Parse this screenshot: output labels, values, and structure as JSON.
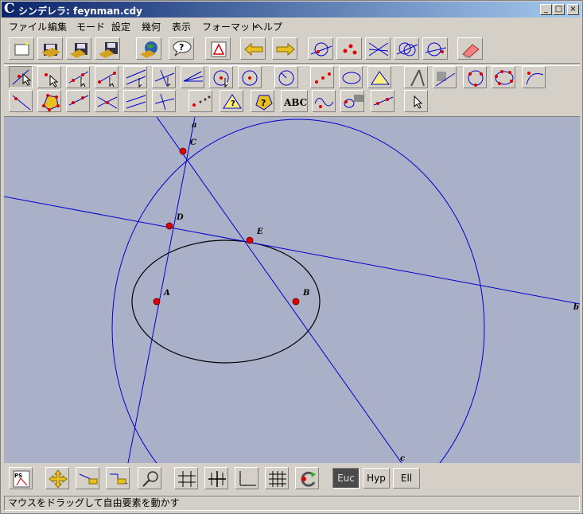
{
  "window": {
    "title": "シンデレラ: feynman.cdy",
    "app_icon": "C",
    "minimize": "_",
    "maximize": "□",
    "close": "×"
  },
  "menu": [
    "ファイル",
    "編集",
    "モード",
    "設定",
    "幾何",
    "表示",
    "フォーマット",
    "ヘルプ"
  ],
  "toolbar_text": {
    "abc_label": "ABC",
    "help_label": "?",
    "ps_label": "PS"
  },
  "geometry_buttons": [
    "Euc",
    "Hyp",
    "Ell"
  ],
  "canvas": {
    "point_labels": [
      "A",
      "B",
      "C",
      "D",
      "E"
    ],
    "line_labels": [
      "a",
      "b",
      "c"
    ],
    "colors": {
      "lines": "#0000cc",
      "points": "#dd0000",
      "ellipse": "#000000",
      "background": "#aab0c8"
    }
  },
  "status": "マウスをドラッグして自由要素を動かす"
}
